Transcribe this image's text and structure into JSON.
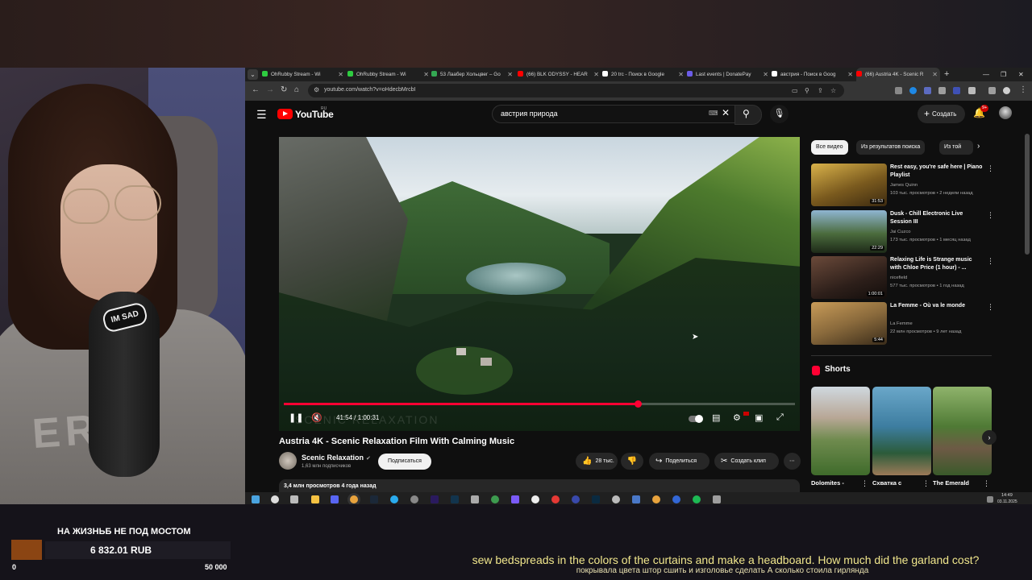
{
  "browser": {
    "tabs": [
      {
        "title": "OhRubby Stream - Wi",
        "color": "#2ecc40"
      },
      {
        "title": "OhRubby Stream - Wi",
        "color": "#2ecc40"
      },
      {
        "title": "53 Лаабер Хольцвег – Go",
        "color": "#34a853"
      },
      {
        "title": "(66) BLK ODYSSY - HEAR",
        "color": "#ff0000"
      },
      {
        "title": "20 trc - Поиск в Google",
        "color": "#ffffff"
      },
      {
        "title": "Last events | DonatePay",
        "color": "#6c5ce7"
      },
      {
        "title": "австрия - Поиск в Goog",
        "color": "#ffffff"
      },
      {
        "title": "(66) Austria 4K - Scenic R",
        "color": "#ff0000"
      }
    ],
    "url": "youtube.com/watch?v=oHdecbMrcbI"
  },
  "youtube": {
    "logo_text": "YouTube",
    "region": "RU",
    "search_query": "австрия природа",
    "create_label": "Создать",
    "notifications": "9+",
    "video": {
      "title": "Austria 4K - Scenic Relaxation Film With Calming Music",
      "time": "41:54 / 1:00:31",
      "progress": 0.692,
      "watermark": "SCENIC RELAXATION",
      "channel": "Scenic Relaxation",
      "subscribers": "1,63 млн подписчиков",
      "subscribe_label": "Подписаться",
      "likes": "28 тыс.",
      "share_label": "Поделиться",
      "clip_label": "Создать клип",
      "meta": "3,4 млн просмотров  4 года назад"
    },
    "chips": [
      "Все видео",
      "Из результатов поиска",
      "Из той"
    ],
    "recommendations": [
      {
        "title": "Rest easy, you're safe here | Piano Playlist",
        "channel": "James Quinn",
        "meta": "103 тыс. просмотров • 2 недели назад",
        "duration": "31:53"
      },
      {
        "title": "Dusk - Chill Electronic Live Session III",
        "channel": "Jai Cuzco",
        "meta": "173 тыс. просмотров • 1 месяц назад",
        "duration": "22:29"
      },
      {
        "title": "Relaxing Life is Strange music with Chloe Price (1 hour) - ...",
        "channel": "nicefield",
        "meta": "577 тыс. просмотров • 1 год назад",
        "duration": "1:00:01"
      },
      {
        "title": "La Femme - Où va le monde",
        "channel": "La Femme",
        "meta": "22 млн просмотров • 9 лет назад",
        "duration": "5:44"
      }
    ],
    "shorts_title": "Shorts",
    "shorts": [
      {
        "title": "Dolomites -"
      },
      {
        "title": "Схватка с"
      },
      {
        "title": "The Emerald"
      }
    ]
  },
  "taskbar": {
    "time": "14:49",
    "date": "03.11.2025"
  },
  "donation": {
    "title": "НА ЖИЗНЬБ НЕ ПОД МОСТОМ",
    "amount": "6 832.01 RUB",
    "min": "0",
    "max": "50 000"
  },
  "subtitles": {
    "en": "sew bedspreads in the colors of the curtains and make a headboard. How much did the garland cost?",
    "ru": "покрывала цвета штор сшить и изголовье сделать А сколько стоила гирлянда"
  },
  "webcam": {
    "mic_sticker": "IM SAD"
  }
}
